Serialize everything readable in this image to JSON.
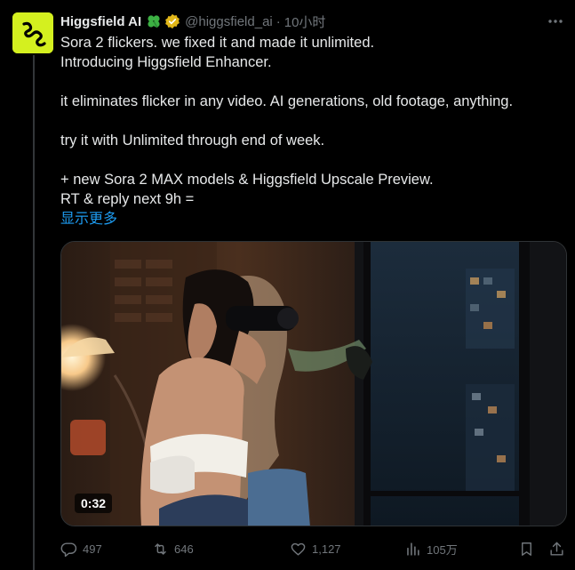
{
  "tweet": {
    "author": {
      "display_name": "Higgsfield AI",
      "handle": "@higgsfield_ai",
      "badge_emoji": "clover-icon",
      "verified": true
    },
    "separator": "·",
    "timestamp": "10小时",
    "text_lines": [
      "Sora 2 flickers. we fixed it and made it unlimited.",
      "Introducing Higgsfield Enhancer.",
      "",
      "it eliminates flicker in any video. AI generations, old footage, anything.",
      "",
      "try it with Unlimited through end of week.",
      "",
      "+ new Sora 2 MAX models & Higgsfield Upscale Preview.",
      "RT & reply next 9h ="
    ],
    "show_more": "显示更多",
    "media": {
      "type": "video",
      "duration": "0:32"
    },
    "stats": {
      "replies": "497",
      "retweets": "646",
      "likes": "1,127",
      "views": "105万"
    }
  },
  "colors": {
    "background": "#000000",
    "text": "#e7e9ea",
    "muted": "#71767b",
    "link": "#1d9bf0",
    "avatar_bg": "#d4f01f",
    "verified_gold": "#e2b719"
  }
}
